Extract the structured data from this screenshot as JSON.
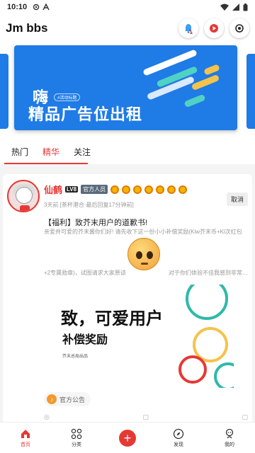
{
  "status_bar": {
    "time": "10:10"
  },
  "app": {
    "title": "Jm bbs"
  },
  "banner": {
    "greeting": "嗨",
    "tag": "#活动标题",
    "headline": "精品广告位出租"
  },
  "tabs": [
    {
      "label": "热门"
    },
    {
      "label": "精华"
    },
    {
      "label": "关注"
    }
  ],
  "post": {
    "username": "仙鹤",
    "level": "LV8",
    "role_badge": "官方人员",
    "meta": "3天前 [茶杯港合·最后回复17分钟前]",
    "cancel_label": "取消",
    "title": "【福利】致芥末用户的道歉书!",
    "excerpt": "亲爱并可爱的芥末酱你们好! 请先收下这一份小小补偿奖励(Kiw芥末币+Kl次红包",
    "excerpt2_left": "+2专属勋章)，试图请求大家原谅",
    "excerpt2_right": "对于你们体验不佳我感到非常…",
    "promo_line1": "致，可爱用户",
    "promo_line2": "补偿奖励",
    "promo_line3": "芥末总局出品",
    "category": "官方公告"
  },
  "bottom_nav": [
    {
      "label": "首页"
    },
    {
      "label": "分类"
    },
    {
      "label": "发现"
    },
    {
      "label": "我的"
    }
  ]
}
